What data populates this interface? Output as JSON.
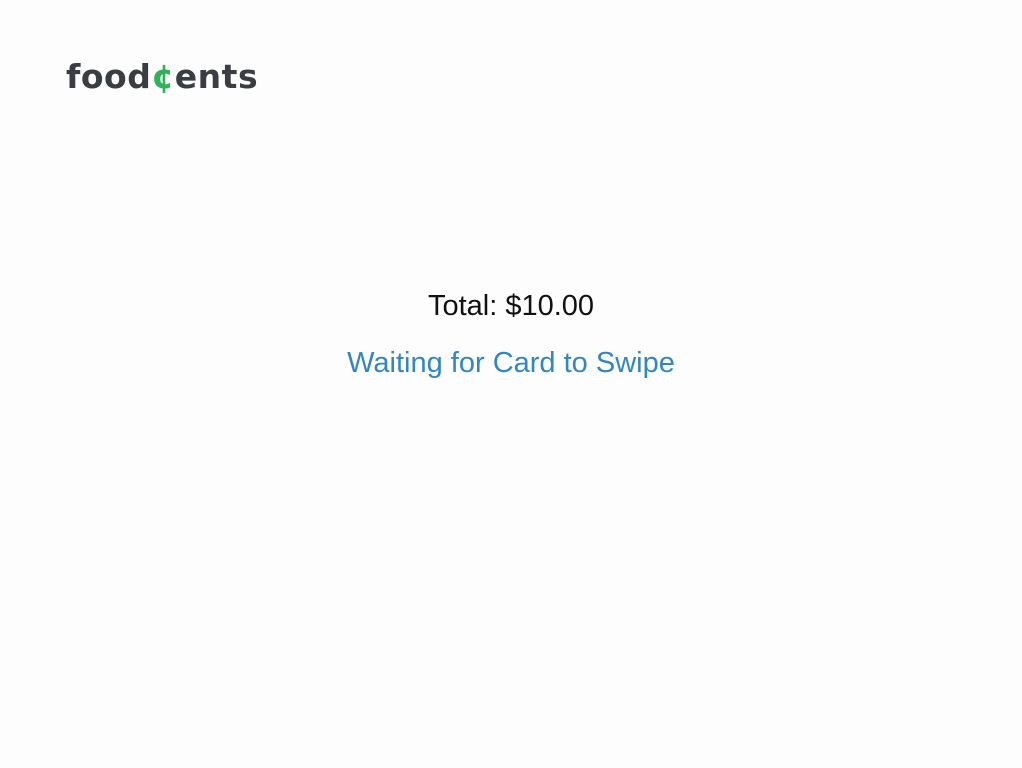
{
  "logo": {
    "part_before": "food",
    "part_accent": "¢",
    "part_after": "ents",
    "colors": {
      "dark": "#3a3d42",
      "accent": "#2fb25a"
    }
  },
  "payment": {
    "total_label": "Total: $10.00",
    "status_text": "Waiting for Card to Swipe"
  },
  "colors": {
    "background": "#fdfdfd",
    "total_text": "#111111",
    "status_text": "#3286c4"
  }
}
